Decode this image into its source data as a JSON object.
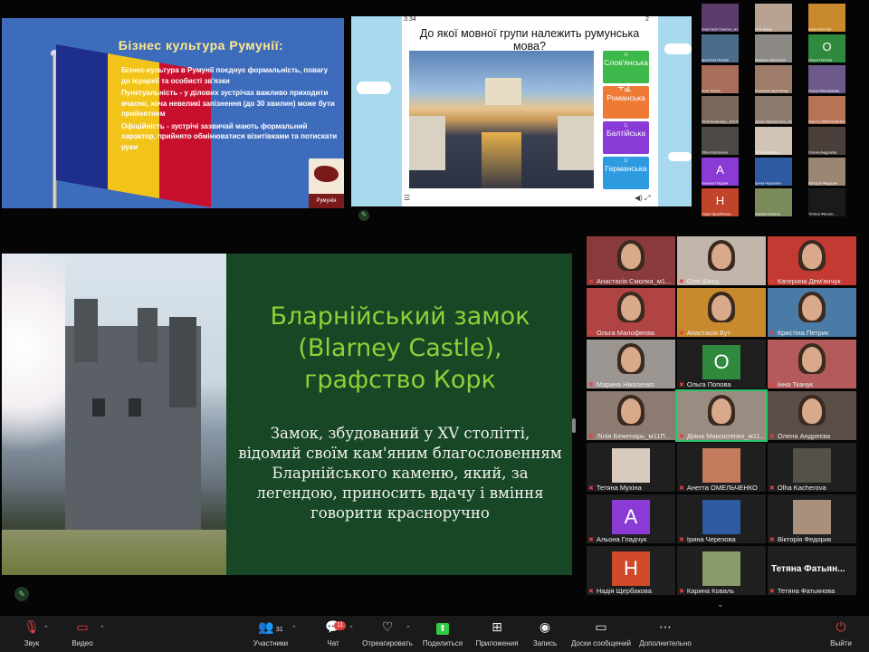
{
  "slide1": {
    "title": "Бізнес культура Румунії:",
    "intro": "Бізнес-культура в Румунії поєднує формальність, повагу до ієрархії та особисті зв'язки",
    "bullet1": "Пунктуальність - у ділових зустрічах важливо приходити вчасно, хоча невеликі запізнення (до 30 хвилин) може бути прийнятним",
    "bullet2": "Офіційність - зустрічі зазвичай мають формальний характер, прийнято обмінюватися візитівками та потискати руки",
    "map_label": "Румунія",
    "flag_colors": [
      "#1d2e8c",
      "#f2c41a",
      "#c8102e"
    ]
  },
  "quiz": {
    "time": "3:34",
    "page": "2",
    "question": "До якої мовної групи належить румунська мова?",
    "answers": [
      {
        "letter": "A",
        "label": "Слов'янська",
        "color": "#3db84b"
      },
      {
        "letter": "B",
        "label": "Романська",
        "color": "#ee7a36"
      },
      {
        "letter": "C",
        "label": "Балтійська",
        "color": "#8a3bd6"
      },
      {
        "letter": "D",
        "label": "Германська",
        "color": "#2e9be0"
      }
    ],
    "overlay": "+1"
  },
  "gallery_small": [
    {
      "name": "Анастасія Смолка_м1...",
      "color": "#5a3d6b"
    },
    {
      "name": "Оля Швед",
      "color": "#b8a292"
    },
    {
      "name": "Анастасія Бут",
      "color": "#c9892d"
    },
    {
      "name": "Кристіна Петрик",
      "color": "#4a6d8c"
    },
    {
      "name": "Марина Ніколенко",
      "color": "#8d8a85"
    },
    {
      "name": "Ольга Попова",
      "color": "#2f8a3d",
      "letter": "O"
    },
    {
      "name": "Інна Ткачук",
      "color": "#a86e5a"
    },
    {
      "name": "Катерина Дем'янчук",
      "color": "#9f7c6a"
    },
    {
      "name": "Ольга Малофеєва",
      "color": "#6d5a8a"
    },
    {
      "name": "Лілія Беженарь_м11П...",
      "color": "#7a685a"
    },
    {
      "name": "Діана Максютенко_м11...",
      "color": "#8a7a6d"
    },
    {
      "name": "Анетта ОМЕЛЬЧЕНКО",
      "color": "#b67356"
    },
    {
      "name": "Olha Kachorova",
      "color": "#4d4a45"
    },
    {
      "name": "Тетяна Мухіна",
      "color": "#d1c4b6"
    },
    {
      "name": "Олена Андреєва",
      "color": "#4a3f3b"
    },
    {
      "name": "Альона Гладчук",
      "color": "#8a3bd6",
      "letter": "A"
    },
    {
      "name": "Ірина Черезова",
      "color": "#2d5aa0"
    },
    {
      "name": "Вікторія Федорик",
      "color": "#9b8573"
    },
    {
      "name": "Надія Щербакова",
      "color": "#c0442a",
      "letter": "H"
    },
    {
      "name": "Карина Коваль",
      "color": "#7a8a5a"
    },
    {
      "name": "Тетяна Фатьян...",
      "color": "#1a1a1a"
    },
    {
      "name": "Тетяна Фатьянова",
      "color": "#1a1a1a"
    }
  ],
  "slide2": {
    "title_line1": "Бларнійський замок",
    "title_line2": "(Blarney Castle),",
    "title_line3": "графство Корк",
    "text": "Замок, збудований у XV столітті, відомий своїм кам'яним благословенням Бларнійського каменю, який, за легендою, приносить вдачу і вміння говорити красноручно"
  },
  "gallery_main": [
    {
      "name": "Анастасія Смолка_м1...",
      "bg": "#8a3a3a",
      "type": "face"
    },
    {
      "name": "Оля Швед",
      "bg": "#c2b6aa",
      "type": "face"
    },
    {
      "name": "Катерина Дем'янчук",
      "bg": "#c33a32",
      "type": "face"
    },
    {
      "name": "Ольга Малофеєва",
      "bg": "#b04343",
      "type": "face"
    },
    {
      "name": "Анастасія Бут",
      "bg": "#c9892d",
      "type": "face"
    },
    {
      "name": "Кристіна Петрик",
      "bg": "#4a7aa6",
      "type": "face"
    },
    {
      "name": "Марина Ніколенко",
      "bg": "#9a9591",
      "type": "face"
    },
    {
      "name": "Ольга Попова",
      "bg": "#1f1f1f",
      "type": "letter",
      "letter": "O",
      "lettercolor": "#2f8a3d"
    },
    {
      "name": "Інна Ткачук",
      "bg": "#b45a5a",
      "type": "face"
    },
    {
      "name": "Лілія Беженарь_м11П...",
      "bg": "#8c7b70",
      "type": "face"
    },
    {
      "name": "Діана Максютенко_м11...",
      "bg": "#9a8c80",
      "type": "face"
    },
    {
      "name": "Олена Андреєва",
      "bg": "#5a4d47",
      "type": "face"
    },
    {
      "name": "Тетяна Мухіна",
      "bg": "#1f1f1f",
      "type": "photo",
      "photocolor": "#d8cbbd"
    },
    {
      "name": "Анетта ОМЕЛЬЧЕНКО",
      "bg": "#1f1f1f",
      "type": "photo",
      "photocolor": "#c57c5c"
    },
    {
      "name": "Olha Kacherova",
      "bg": "#1f1f1f",
      "type": "photo",
      "photocolor": "#55504a"
    },
    {
      "name": "Альона Гладчук",
      "bg": "#1f1f1f",
      "type": "letter",
      "letter": "A",
      "lettercolor": "#8a3bd6"
    },
    {
      "name": "Ірина Черезова",
      "bg": "#1f1f1f",
      "type": "photo",
      "photocolor": "#2d5aa0"
    },
    {
      "name": "Вікторія Федорик",
      "bg": "#1f1f1f",
      "type": "photo",
      "photocolor": "#a8907c"
    },
    {
      "name": "Надія Щербакова",
      "bg": "#1f1f1f",
      "type": "letter",
      "letter": "H",
      "lettercolor": "#d04a2a"
    },
    {
      "name": "Карина Коваль",
      "bg": "#1f1f1f",
      "type": "photo",
      "photocolor": "#8a9a6a"
    },
    {
      "name": "Тетяна Фатьянова",
      "bg": "#1f1f1f",
      "type": "bigname",
      "bigname": "Тетяна Фатьян..."
    }
  ],
  "toolbar": {
    "audio": "Звук",
    "video": "Видео",
    "participants": "Участники",
    "participants_count": "31",
    "chat": "Чат",
    "chat_badge": "11",
    "react": "Отреагировать",
    "share": "Поделиться",
    "apps": "Приложения",
    "record": "Запись",
    "whiteboards": "Доски сообщений",
    "more": "Дополнительно",
    "leave": "Выйти"
  }
}
